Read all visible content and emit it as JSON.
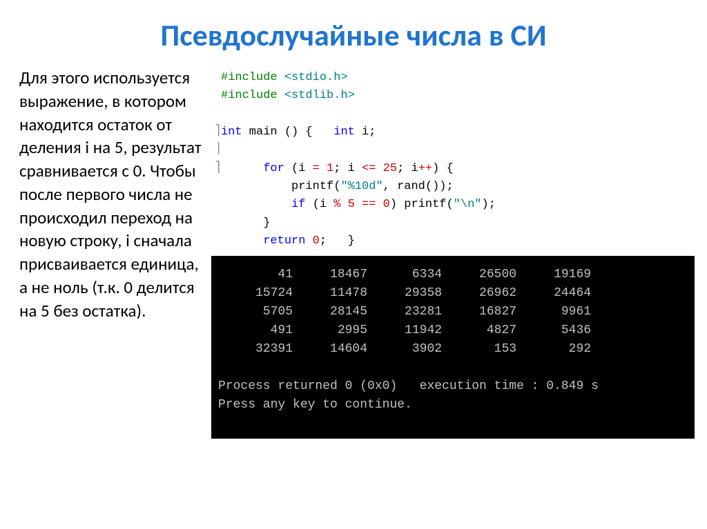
{
  "title": "Псевдослучайные числа в СИ",
  "description": "Для этого используется выражение, в котором находится остаток от деления i на 5, результат сравнивается с 0. Чтобы после первого числа не происходил переход на новую строку, i сначала присваивается единица, а не ноль (т.к. 0 делится на 5 без остатка).",
  "code": {
    "l1a": "#include ",
    "l1b": "<stdio.h>",
    "l2a": "#include ",
    "l2b": "<stdlib.h>",
    "l3_int": "int",
    "l3_main": " main ",
    "l3_p": "()",
    "l3_brace": " {   ",
    "l3_int2": "int",
    "l3_i": " i",
    "l3_semi": ";",
    "l4_for": "for",
    "l4_open": " (",
    "l4_i1": "i ",
    "l4_eq": "= ",
    "l4_one": "1",
    "l4_semi1": "; ",
    "l4_i2": "i ",
    "l4_le": "<= ",
    "l4_25": "25",
    "l4_semi2": "; ",
    "l4_i3": "i",
    "l4_pp": "++",
    "l4_close": ") ",
    "l4_brace": "{",
    "l5_printf": "printf",
    "l5_open": "(",
    "l5_fmt": "\"%10d\"",
    "l5_comma": ", ",
    "l5_rand": "rand",
    "l5_p": "()",
    "l5_close": ")",
    "l5_semi": ";",
    "l6_if": "if",
    "l6_open": " (",
    "l6_i": "i ",
    "l6_mod": "% ",
    "l6_5": "5",
    "l6_eqeq": " == ",
    "l6_0": "0",
    "l6_close": ") ",
    "l6_printf": "printf",
    "l6_p2o": "(",
    "l6_nl": "\"\\n\"",
    "l6_p2c": ")",
    "l6_semi": ";",
    "l7_brace": "}",
    "l8_return": "return",
    "l8_sp": " ",
    "l8_0": "0",
    "l8_semi": ";",
    "l8_sp2": "   ",
    "l8_brace": "}"
  },
  "console": {
    "rows": [
      [
        "41",
        "18467",
        "6334",
        "26500",
        "19169"
      ],
      [
        "15724",
        "11478",
        "29358",
        "26962",
        "24464"
      ],
      [
        "5705",
        "28145",
        "23281",
        "16827",
        "9961"
      ],
      [
        "491",
        "2995",
        "11942",
        "4827",
        "5436"
      ],
      [
        "32391",
        "14604",
        "3902",
        "153",
        "292"
      ]
    ],
    "status1": "Process returned 0 (0x0)   execution time : 0.849 s",
    "status2": "Press any key to continue."
  }
}
